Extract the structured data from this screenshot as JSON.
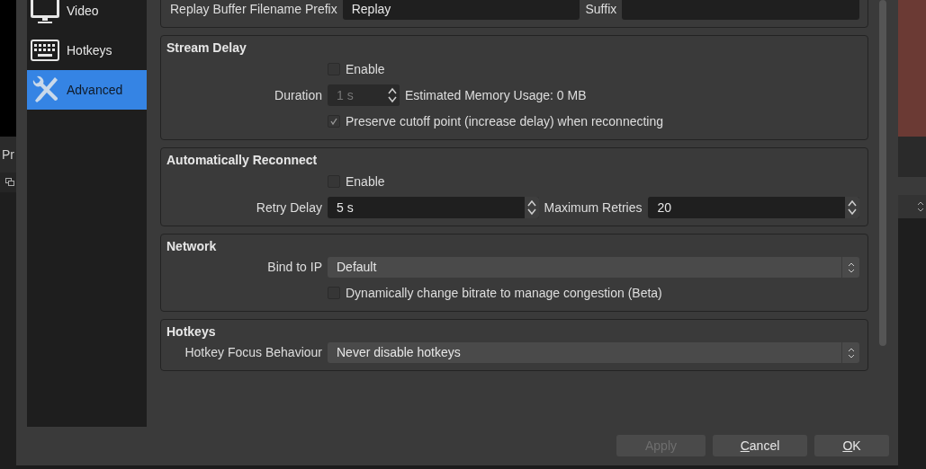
{
  "background": {
    "panel_label": "Pr"
  },
  "sidebar": {
    "items": [
      {
        "label": "Video",
        "selected": false
      },
      {
        "label": "Hotkeys",
        "selected": false
      },
      {
        "label": "Advanced",
        "selected": true
      }
    ]
  },
  "sections": [
    {
      "rows": [
        {
          "kind": "pair",
          "label": "Replay Buffer Filename Prefix",
          "value": "Replay",
          "label2": "Suffix"
        }
      ]
    },
    {
      "title": "Stream Delay",
      "rows": [
        {
          "kind": "checkbox",
          "label": "Enable",
          "checked": false,
          "disabled": false
        },
        {
          "kind": "spin",
          "label": "Duration",
          "value": "1 s",
          "disabled": true,
          "note": "Estimated Memory Usage: 0 MB"
        },
        {
          "kind": "checkbox",
          "label": "Preserve cutoff point (increase delay) when reconnecting",
          "checked": true,
          "disabled": false
        }
      ]
    },
    {
      "title": "Automatically Reconnect",
      "rows": [
        {
          "kind": "checkbox",
          "label": "Enable",
          "checked": false,
          "disabled": false
        },
        {
          "kind": "spin_pair",
          "label": "Retry Delay",
          "value": "5 s",
          "label2": "Maximum Retries",
          "value2": "20"
        }
      ]
    },
    {
      "title": "Network",
      "rows": [
        {
          "kind": "combo",
          "label": "Bind to IP",
          "value": "Default"
        },
        {
          "kind": "checkbox",
          "label": "Dynamically change bitrate to manage congestion (Beta)",
          "checked": false,
          "disabled": false
        }
      ]
    },
    {
      "title": "Hotkeys",
      "rows": [
        {
          "kind": "combo",
          "label": "Hotkey Focus Behaviour",
          "value": "Never disable hotkeys"
        }
      ]
    }
  ],
  "buttons": [
    {
      "label": "Apply",
      "disabled": true,
      "shortcut_underlined": false
    },
    {
      "label": "Cancel",
      "disabled": false,
      "shortcut_underlined": true
    },
    {
      "label": "OK",
      "disabled": false,
      "shortcut_underlined": true
    }
  ]
}
